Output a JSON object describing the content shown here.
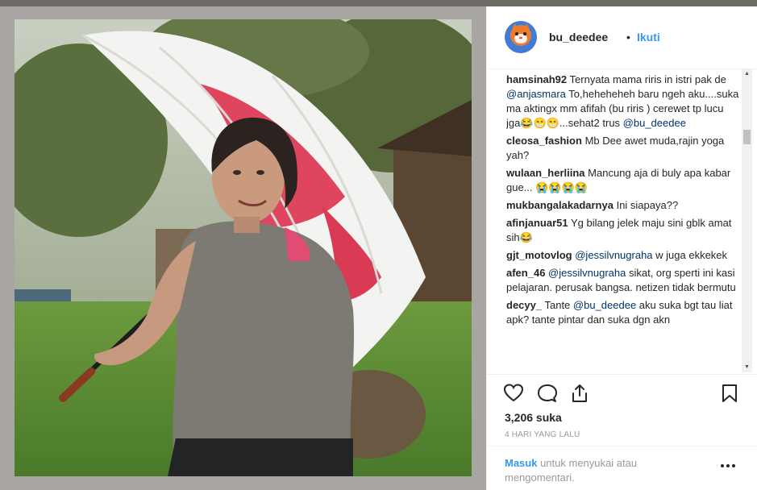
{
  "post": {
    "username": "bu_deedee",
    "separator": "•",
    "follow_label": "Ikuti"
  },
  "comments": [
    {
      "user": "hamsinah92",
      "parts": [
        {
          "t": "text",
          "v": "Ternyata mama riris in istri pak de "
        },
        {
          "t": "mention",
          "v": "@anjasmara"
        },
        {
          "t": "text",
          "v": " To,heheheheh baru ngeh aku....suka ma aktingx mm afifah (bu riris ) cerewet tp lucu jga😂😁😁...sehat2 trus "
        },
        {
          "t": "mention",
          "v": "@bu_deedee"
        }
      ]
    },
    {
      "user": "cleosa_fashion",
      "parts": [
        {
          "t": "text",
          "v": "Mb Dee awet muda,rajin yoga yah?"
        }
      ]
    },
    {
      "user": "wulaan_herliina",
      "parts": [
        {
          "t": "text",
          "v": "Mancung aja di buly apa kabar gue... 😭😭😭😭"
        }
      ]
    },
    {
      "user": "mukbangalakadarnya",
      "parts": [
        {
          "t": "text",
          "v": "Ini siapaya??"
        }
      ]
    },
    {
      "user": "afinjanuar51",
      "parts": [
        {
          "t": "text",
          "v": "Yg bilang jelek maju sini gblk amat sih😂"
        }
      ]
    },
    {
      "user": "gjt_motovlog",
      "parts": [
        {
          "t": "mention",
          "v": "@jessilvnugraha"
        },
        {
          "t": "text",
          "v": " w juga ekkekek"
        }
      ]
    },
    {
      "user": "afen_46",
      "parts": [
        {
          "t": "mention",
          "v": "@jessilvnugraha"
        },
        {
          "t": "text",
          "v": " sikat, org sperti ini kasi pelajaran. perusak bangsa. netizen tidak bermutu"
        }
      ]
    },
    {
      "user": "decyy_",
      "parts": [
        {
          "t": "text",
          "v": "Tante "
        },
        {
          "t": "mention",
          "v": "@bu_deedee"
        },
        {
          "t": "text",
          "v": " aku suka bgt tau liat apk? tante pintar dan suka dgn akn"
        }
      ]
    }
  ],
  "likes": "3,206 suka",
  "timestamp": "4 HARI YANG LALU",
  "login": {
    "link_label": "Masuk",
    "rest": " untuk menyukai atau mengomentari."
  },
  "icons": {
    "like": "heart-icon",
    "comment": "comment-icon",
    "share": "share-icon",
    "save": "bookmark-icon",
    "more": "more-options-icon"
  },
  "colors": {
    "link": "#3897f0",
    "mention": "#003569",
    "text": "#262626",
    "muted": "#999999"
  }
}
